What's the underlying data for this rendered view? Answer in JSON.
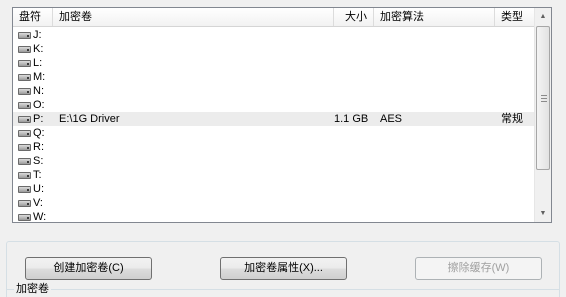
{
  "columns": {
    "drive": "盘符",
    "volume": "加密卷",
    "size": "大小",
    "algorithm": "加密算法",
    "type": "类型"
  },
  "rows": [
    {
      "drive": "J:",
      "volume": "",
      "size": "",
      "algorithm": "",
      "type": "",
      "selected": false
    },
    {
      "drive": "K:",
      "volume": "",
      "size": "",
      "algorithm": "",
      "type": "",
      "selected": false
    },
    {
      "drive": "L:",
      "volume": "",
      "size": "",
      "algorithm": "",
      "type": "",
      "selected": false
    },
    {
      "drive": "M:",
      "volume": "",
      "size": "",
      "algorithm": "",
      "type": "",
      "selected": false
    },
    {
      "drive": "N:",
      "volume": "",
      "size": "",
      "algorithm": "",
      "type": "",
      "selected": false
    },
    {
      "drive": "O:",
      "volume": "",
      "size": "",
      "algorithm": "",
      "type": "",
      "selected": false
    },
    {
      "drive": "P:",
      "volume": "E:\\1G Driver",
      "size": "1.1 GB",
      "algorithm": "AES",
      "type": "常规",
      "selected": true
    },
    {
      "drive": "Q:",
      "volume": "",
      "size": "",
      "algorithm": "",
      "type": "",
      "selected": false
    },
    {
      "drive": "R:",
      "volume": "",
      "size": "",
      "algorithm": "",
      "type": "",
      "selected": false
    },
    {
      "drive": "S:",
      "volume": "",
      "size": "",
      "algorithm": "",
      "type": "",
      "selected": false
    },
    {
      "drive": "T:",
      "volume": "",
      "size": "",
      "algorithm": "",
      "type": "",
      "selected": false
    },
    {
      "drive": "U:",
      "volume": "",
      "size": "",
      "algorithm": "",
      "type": "",
      "selected": false
    },
    {
      "drive": "V:",
      "volume": "",
      "size": "",
      "algorithm": "",
      "type": "",
      "selected": false
    },
    {
      "drive": "W:",
      "volume": "",
      "size": "",
      "algorithm": "",
      "type": "",
      "selected": false
    }
  ],
  "buttons": {
    "create": "创建加密卷(C)",
    "properties": "加密卷属性(X)...",
    "wipe_cache": "擦除缓存(W)"
  },
  "group_label": "加密卷",
  "icons": {
    "drive": "drive-icon",
    "scroll_up": "scroll-up-arrow-icon",
    "scroll_down": "scroll-down-arrow-icon"
  }
}
